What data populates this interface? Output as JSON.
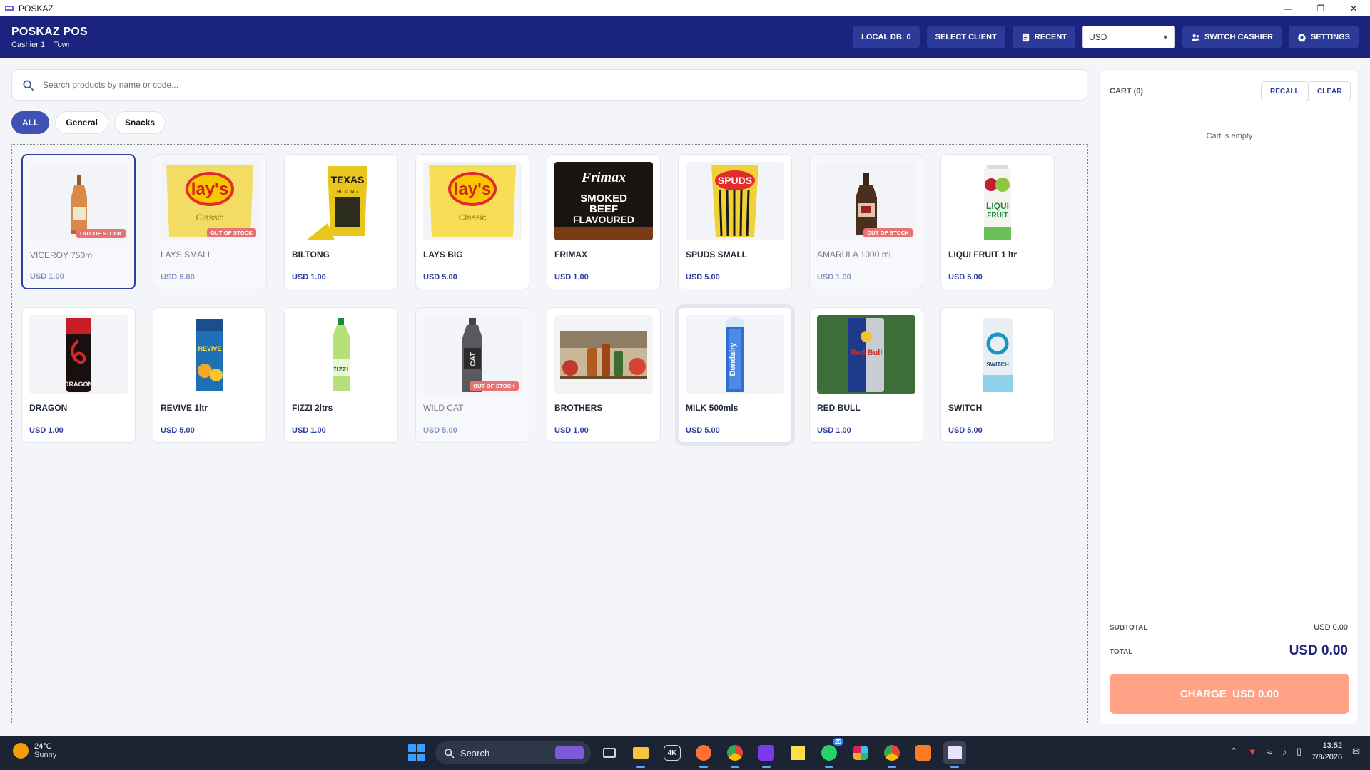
{
  "window": {
    "title": "POSKAZ",
    "icon": "poskaz-app-icon"
  },
  "header": {
    "brand": "POSKAZ POS",
    "cashier": "Cashier 1",
    "location": "Town",
    "local_db": "LOCAL DB: 0",
    "select_client": "SELECT CLIENT",
    "recent": "RECENT",
    "currency": "USD",
    "switch_cashier": "SWITCH CASHIER",
    "settings": "SETTINGS"
  },
  "search": {
    "placeholder": "Search products by name or code..."
  },
  "categories": [
    "ALL",
    "General",
    "Snacks"
  ],
  "products": [
    {
      "name": "VICEROY 750ml",
      "price": "USD 1.00",
      "badge": "OUT OF STOCK"
    },
    {
      "name": "LAYS SMALL",
      "price": "USD 5.00",
      "badge": "OUT OF STOCK"
    },
    {
      "name": "BILTONG",
      "price": "USD 1.00",
      "badge": ""
    },
    {
      "name": "LAYS BIG",
      "price": "USD 5.00",
      "badge": ""
    },
    {
      "name": "FRIMAX",
      "price": "USD 1.00",
      "badge": ""
    },
    {
      "name": "SPUDS SMALL",
      "price": "USD 5.00",
      "badge": ""
    },
    {
      "name": "AMARULA 1000 ml",
      "price": "USD 1.00",
      "badge": "OUT OF STOCK"
    },
    {
      "name": "LIQUI FRUIT 1 ltr",
      "price": "USD 5.00",
      "badge": ""
    },
    {
      "name": "DRAGON",
      "price": "USD 1.00",
      "badge": ""
    },
    {
      "name": "REVIVE 1ltr",
      "price": "USD 5.00",
      "badge": ""
    },
    {
      "name": "FIZZI 2ltrs",
      "price": "USD 1.00",
      "badge": ""
    },
    {
      "name": "WILD CAT",
      "price": "USD 5.00",
      "badge": "OUT OF STOCK"
    },
    {
      "name": "BROTHERS",
      "price": "USD 1.00",
      "badge": ""
    },
    {
      "name": "MILK 500mls",
      "price": "USD 5.00",
      "badge": ""
    },
    {
      "name": "RED BULL",
      "price": "USD 1.00",
      "badge": ""
    },
    {
      "name": "SWITCH",
      "price": "USD 5.00",
      "badge": ""
    }
  ],
  "product_images": {
    "lays_brand": "lay's",
    "lays_flavor": "Classic",
    "biltong_brand": "TEXAS",
    "biltong_sub": "BILTONG",
    "frimax_brand": "Frimax",
    "frimax_flavor_1": "SMOKED",
    "frimax_flavor_2": "BEEF",
    "frimax_flavor_3": "FLAVOURED",
    "spuds_brand": "SPUDS",
    "liqui_brand_1": "LIQUI",
    "liqui_brand_2": "FRUIT",
    "dragon_brand": "DRAGON",
    "revive_brand": "REVIVE",
    "fizzi_brand": "fizzi",
    "wildcat_brand": "CAT",
    "milk_brand": "Dendairy",
    "redbull_brand": "Red Bull",
    "switch_brand": "SWITCH"
  },
  "cart": {
    "title": "CART (0)",
    "recall": "RECALL",
    "clear": "CLEAR",
    "empty_text": "Cart is empty",
    "subtotal_label": "SUBTOTAL",
    "subtotal_value": "USD 0.00",
    "total_label": "TOTAL",
    "total_value": "USD 0.00",
    "charge": "CHARGE  USD 0.00"
  },
  "taskbar": {
    "weather_temp": "24°C",
    "weather_desc": "Sunny",
    "search": "Search",
    "time": "13:52",
    "date": "7/8/2026",
    "whatsapp_badge": "25",
    "icons": [
      "task-view-icon",
      "file-explorer-icon",
      "4k-app-icon",
      "firefox-icon",
      "chrome-icon",
      "phpstorm-icon",
      "sticky-notes-icon",
      "whatsapp-icon",
      "slack-icon",
      "chrome-profile-icon",
      "xampp-icon",
      "poskaz-taskbar-icon"
    ]
  }
}
